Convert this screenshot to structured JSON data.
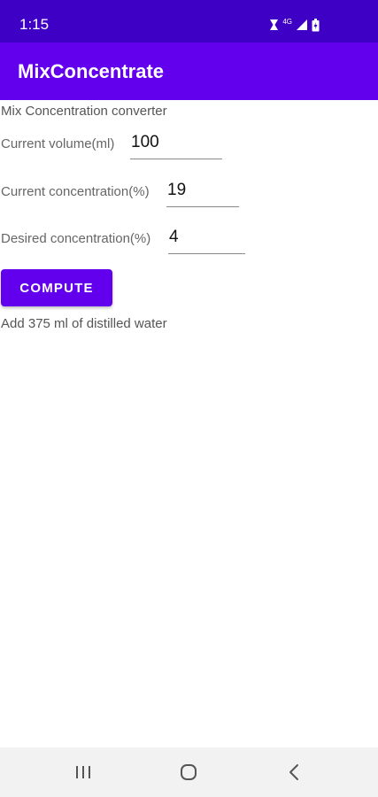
{
  "status_bar": {
    "time": "1:15",
    "network_label": "4G",
    "background": "#3f00c6",
    "icons": [
      "alarm-icon",
      "network-icon",
      "signal-icon",
      "battery-icon"
    ]
  },
  "app_bar": {
    "title": "MixConcentrate",
    "background": "#6200ee"
  },
  "main": {
    "subtitle": "Mix Concentration converter",
    "fields": {
      "current_volume": {
        "label": "Current volume(ml)",
        "value": "100"
      },
      "current_concentration": {
        "label": "Current concentration(%)",
        "value": "19"
      },
      "desired_concentration": {
        "label": "Desired concentration(%)",
        "value": "4"
      }
    },
    "compute_label": "COMPUTE",
    "result": "Add 375 ml of distilled water",
    "accent": "#6200ee"
  },
  "nav_bar": {
    "icons": [
      "recents-icon",
      "home-icon",
      "back-icon"
    ]
  }
}
